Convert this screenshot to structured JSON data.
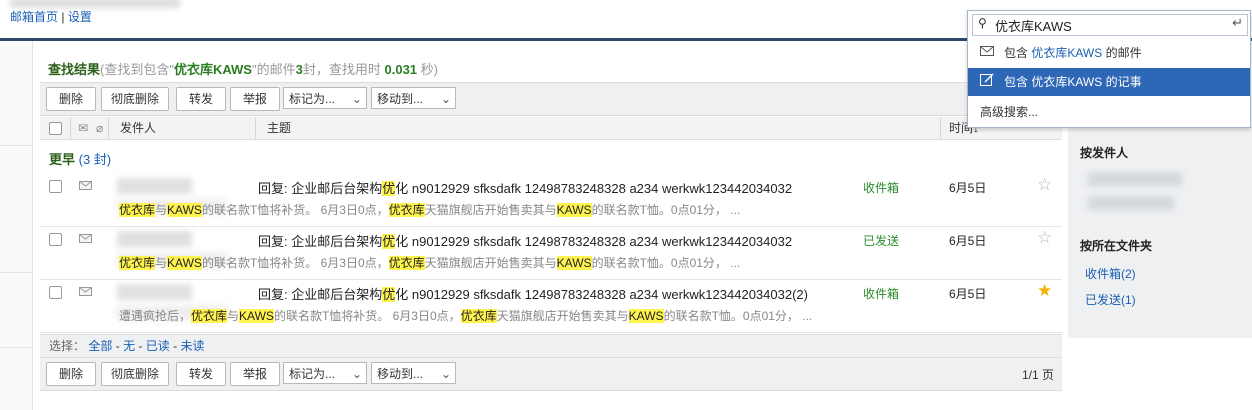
{
  "header": {
    "links": [
      "邮箱首页",
      "设置"
    ],
    "separator": "|"
  },
  "search": {
    "query": "优衣库KAWS",
    "options": [
      {
        "prefix": "包含",
        "keyword": "优衣库KAWS",
        "suffix": "的邮件",
        "icon": "envelope-icon"
      },
      {
        "prefix": "包含",
        "keyword": "优衣库KAWS",
        "suffix": "的记事",
        "icon": "note-edit-icon"
      }
    ],
    "advanced": "高级搜索..."
  },
  "result": {
    "title": "查找结果",
    "desc_open": "(查找到包含\"",
    "keyword": "优衣库KAWS",
    "desc_mid": "\"的邮件",
    "count": "3",
    "unit": "封",
    "time_label": "，查找用时",
    "time": "0.031",
    "time_unit": "秒)"
  },
  "toolbar": {
    "delete": "删除",
    "delete_forever": "彻底删除",
    "forward": "转发",
    "report": "举报",
    "mark_as": "标记为...",
    "move_to": "移动到..."
  },
  "columns": {
    "sender": "发件人",
    "subject": "主题",
    "time": "时间"
  },
  "group": {
    "label": "更早",
    "count": "(3 封)"
  },
  "emails": [
    {
      "subject_a": "回复: 企业邮后台架构",
      "subject_hl": "优",
      "subject_b": "化 n9012929 sfksdafk 12498783248328 a234 werkwk123442034032",
      "preview_a": "",
      "preview_parts": [
        "优衣库",
        "与",
        "KAWS",
        "的联名款T恤将补货。 6月3日0点，",
        "优衣库",
        "天猫旗舰店开始售卖其与",
        "KAWS",
        "的联名款T恤。0点01分， ..."
      ],
      "folder": "收件箱",
      "date": "6月5日",
      "starred": false
    },
    {
      "subject_a": "回复: 企业邮后台架构",
      "subject_hl": "优",
      "subject_b": "化 n9012929 sfksdafk 12498783248328 a234 werkwk123442034032",
      "preview_a": "",
      "preview_parts": [
        "优衣库",
        "与",
        "KAWS",
        "的联名款T恤将补货。 6月3日0点，",
        "优衣库",
        "天猫旗舰店开始售卖其与",
        "KAWS",
        "的联名款T恤。0点01分， ..."
      ],
      "folder": "已发送",
      "date": "6月5日",
      "starred": false
    },
    {
      "subject_a": "回复: 企业邮后台架构",
      "subject_hl": "优",
      "subject_b": "化 n9012929 sfksdafk 12498783248328 a234 werkwk123442034032(2)",
      "preview_a": "遭遇疯抢后，",
      "preview_parts": [
        "优衣库",
        "与",
        "KAWS",
        "的联名款T恤将补货。 6月3日0点，",
        "优衣库",
        "天猫旗舰店开始售卖其与",
        "KAWS",
        "的联名款T恤。0点01分， ..."
      ],
      "folder": "收件箱",
      "date": "6月5日",
      "starred": true
    }
  ],
  "selectbar": {
    "label": "选择：",
    "all": "全部",
    "none": "无",
    "read": "已读",
    "unread": "未读",
    "dash": "-"
  },
  "pagination": "1/1 页",
  "sidebar": {
    "by_sender": "按发件人",
    "by_folder": "按所在文件夹",
    "folders": [
      "收件箱(2)",
      "已发送(1)"
    ]
  }
}
